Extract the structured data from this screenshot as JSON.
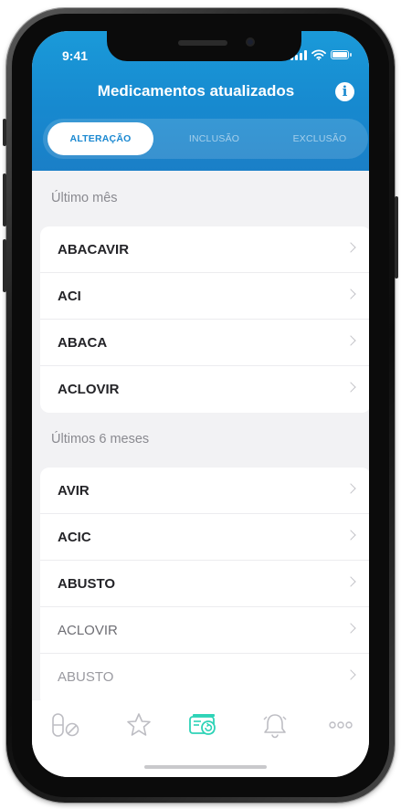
{
  "status_bar": {
    "time": "9:41"
  },
  "header": {
    "title": "Medicamentos atualizados",
    "info_icon": "info-icon"
  },
  "segments": [
    {
      "label": "ALTERAÇÃO",
      "active": true
    },
    {
      "label": "INCLUSÃO",
      "active": false
    },
    {
      "label": "EXCLUSÃO",
      "active": false
    }
  ],
  "sections": [
    {
      "label": "Último mês",
      "items": [
        {
          "label": "ABACAVIR"
        },
        {
          "label": "ACI"
        },
        {
          "label": "ABACA"
        },
        {
          "label": "ACLOVIR"
        }
      ]
    },
    {
      "label": "Últimos 6 meses",
      "items": [
        {
          "label": "AVIR"
        },
        {
          "label": "ACIC"
        },
        {
          "label": "ABUSTO"
        },
        {
          "label": "ACLOVIR"
        },
        {
          "label": "ABUSTO"
        }
      ]
    }
  ],
  "tabbar": {
    "icons": [
      "pill-icon",
      "star-icon",
      "updates-icon",
      "bell-icon",
      "more-icon"
    ],
    "active_color": "#2ed3b7",
    "inactive_color": "#bdbdc3"
  },
  "colors": {
    "header": "#1789cf",
    "accent": "#1a88d1"
  }
}
